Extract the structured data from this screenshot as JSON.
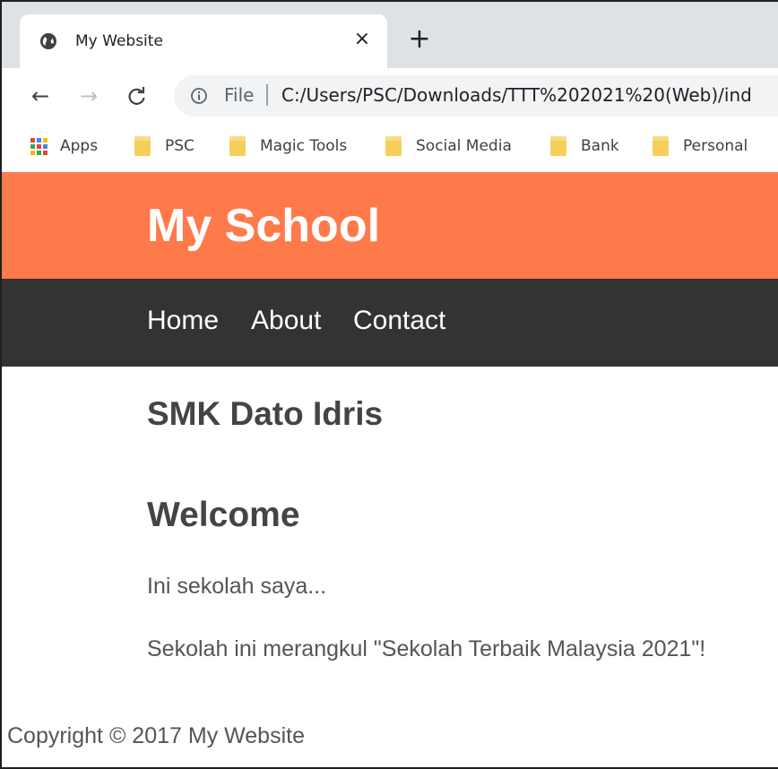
{
  "tab": {
    "title": "My Website",
    "close_icon": "×",
    "new_tab_icon": "+"
  },
  "toolbar": {
    "back_icon": "←",
    "forward_icon": "→",
    "reload_icon": "C",
    "scheme_label": "File",
    "url": "C:/Users/PSC/Downloads/TTT%202021%20(Web)/ind"
  },
  "bookmarks": [
    {
      "label": "Apps",
      "icon": "apps-grid-icon"
    },
    {
      "label": "PSC",
      "icon": "folder-icon"
    },
    {
      "label": "Magic Tools",
      "icon": "folder-icon"
    },
    {
      "label": "Social Media",
      "icon": "folder-icon"
    },
    {
      "label": "Bank",
      "icon": "folder-icon"
    },
    {
      "label": "Personal",
      "icon": "folder-icon"
    }
  ],
  "site": {
    "title": "My School",
    "nav": [
      "Home",
      "About",
      "Contact"
    ],
    "school_name": "SMK Dato Idris",
    "welcome_heading": "Welcome",
    "paragraphs": [
      "Ini sekolah saya...",
      "Sekolah ini merangkul \"Sekolah Terbaik Malaysia 2021\"!"
    ],
    "footer": "Copyright © 2017 My Website"
  },
  "colors": {
    "header_bg": "#ff7a4a",
    "nav_bg": "#333333",
    "tabstrip_bg": "#dee1e6"
  }
}
